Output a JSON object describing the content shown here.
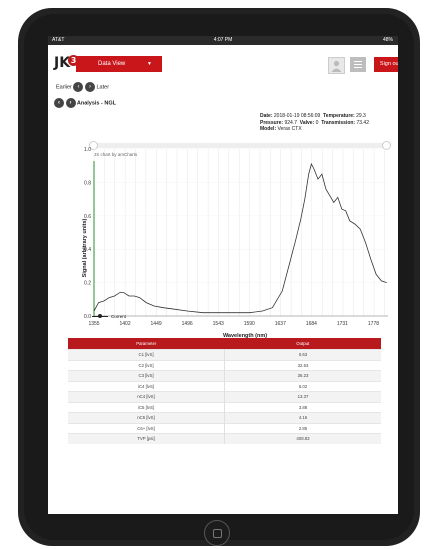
{
  "status": {
    "carrier": "AT&T",
    "time": "4:07 PM",
    "battery": "48%"
  },
  "app": {
    "logo_text": "JK",
    "logo_badge": "3",
    "data_view_label": "Data View",
    "sign_out_label": "Sign out"
  },
  "nav": {
    "earlier_label": "Earlier",
    "later_label": "Later",
    "analysis_label": "Analysis - NGL"
  },
  "meta": {
    "date_label": "Date:",
    "date_value": "2018-01-19 08:56:09",
    "temperature_label": "Temperature:",
    "temperature_value": "29.3",
    "pressure_label": "Pressure:",
    "pressure_value": "924.7",
    "valve_label": "Valve:",
    "valve_value": "0",
    "transmission_label": "Transmission:",
    "transmission_value": "73.42",
    "model_label": "Model:",
    "model_value": "Verax CTX"
  },
  "chart_data": {
    "type": "line",
    "credit": "JS chart by amCharts",
    "xlabel": "Wavelength (nm)",
    "ylabel": "Signal (arbitrary units)",
    "xlim": [
      1355,
      1800
    ],
    "ylim": [
      0,
      1.0
    ],
    "x_ticks": [
      "1355",
      "1402",
      "1449",
      "1496",
      "1543",
      "1590",
      "1637",
      "1684",
      "1731",
      "1778"
    ],
    "y_ticks": [
      "0.0",
      "0.2",
      "0.4",
      "0.6",
      "0.8",
      "1.0"
    ],
    "series": [
      {
        "name": "Current",
        "color": "#333333",
        "x": [
          1355,
          1362,
          1370,
          1378,
          1386,
          1394,
          1400,
          1408,
          1416,
          1424,
          1434,
          1446,
          1460,
          1478,
          1496,
          1520,
          1543,
          1566,
          1590,
          1610,
          1625,
          1640,
          1650,
          1660,
          1668,
          1674,
          1680,
          1684,
          1688,
          1694,
          1700,
          1706,
          1712,
          1718,
          1724,
          1730,
          1736,
          1742,
          1750,
          1758,
          1766,
          1774,
          1782,
          1790,
          1798
        ],
        "y": [
          0.03,
          0.08,
          0.09,
          0.11,
          0.12,
          0.14,
          0.14,
          0.12,
          0.12,
          0.11,
          0.08,
          0.06,
          0.05,
          0.04,
          0.03,
          0.02,
          0.02,
          0.02,
          0.02,
          0.03,
          0.05,
          0.15,
          0.3,
          0.45,
          0.58,
          0.7,
          0.85,
          0.91,
          0.88,
          0.82,
          0.85,
          0.76,
          0.72,
          0.68,
          0.71,
          0.64,
          0.63,
          0.57,
          0.55,
          0.52,
          0.44,
          0.34,
          0.25,
          0.21,
          0.2
        ]
      }
    ]
  },
  "legend": {
    "label": "Current"
  },
  "table": {
    "headers": [
      "Parameter",
      "Output"
    ],
    "rows": [
      [
        "C1 [lvS]",
        "0.63"
      ],
      [
        "C2 [lvS]",
        "32.53"
      ],
      [
        "C3 [lvS]",
        "36.23"
      ],
      [
        "iC4 [lvS]",
        "6.02"
      ],
      [
        "nC4 [lvS]",
        "13.37"
      ],
      [
        "iC5 [lvS]",
        "3.88"
      ],
      [
        "nC5 [lvS]",
        "4.16"
      ],
      [
        "C6+ [lvS]",
        "2.85"
      ],
      [
        "TVP [psi]",
        "408.83"
      ]
    ]
  }
}
